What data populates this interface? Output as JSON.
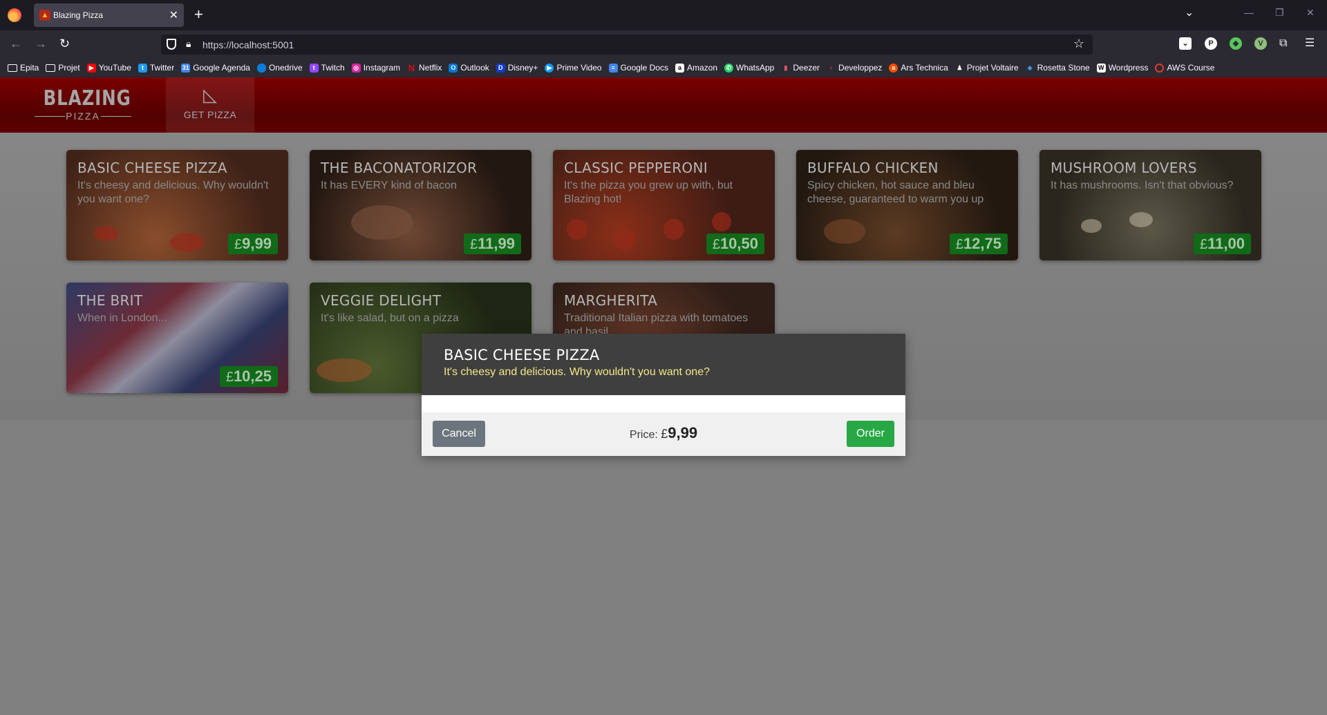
{
  "browser": {
    "tab_title": "Blazing Pizza",
    "new_tab": "+",
    "url": "https://localhost:5001",
    "bookmarks": [
      "Epita",
      "Projet",
      "YouTube",
      "Twitter",
      "Google Agenda",
      "Onedrive",
      "Twitch",
      "Instagram",
      "Netflix",
      "Outlook",
      "Disney+",
      "Prime Video",
      "Google Docs",
      "Amazon",
      "WhatsApp",
      "Deezer",
      "Developpez",
      "Ars Technica",
      "Projet Voltaire",
      "Rosetta Stone",
      "Wordpress",
      "AWS Course"
    ]
  },
  "app": {
    "logo_main": "BLAZING",
    "logo_sub": "PIZZA",
    "nav_get_pizza": "GET PIZZA",
    "specials": [
      {
        "name": "BASIC CHEESE PIZZA",
        "description": "It's cheesy and delicious. Why wouldn't you want one?",
        "currency": "£",
        "price": "9,99"
      },
      {
        "name": "THE BACONATORIZOR",
        "description": "It has EVERY kind of bacon",
        "currency": "£",
        "price": "11,99"
      },
      {
        "name": "CLASSIC PEPPERONI",
        "description": "It's the pizza you grew up with, but Blazing hot!",
        "currency": "£",
        "price": "10,50"
      },
      {
        "name": "BUFFALO CHICKEN",
        "description": "Spicy chicken, hot sauce and bleu cheese, guaranteed to warm you up",
        "currency": "£",
        "price": "12,75"
      },
      {
        "name": "MUSHROOM LOVERS",
        "description": "It has mushrooms. Isn't that obvious?",
        "currency": "£",
        "price": "11,00"
      },
      {
        "name": "THE BRIT",
        "description": "When in London...",
        "currency": "£",
        "price": "10,25"
      },
      {
        "name": "VEGGIE DELIGHT",
        "description": "It's like salad, but on a pizza",
        "currency": "£",
        "price": ""
      },
      {
        "name": "MARGHERITA",
        "description": "Traditional Italian pizza with tomatoes and basil",
        "currency": "£",
        "price": ""
      }
    ]
  },
  "dialog": {
    "title": "BASIC CHEESE PIZZA",
    "description": "It's cheesy and delicious. Why wouldn't you want one?",
    "cancel_label": "Cancel",
    "price_label": "Price:",
    "currency": "£",
    "price": "9,99",
    "order_label": "Order"
  }
}
